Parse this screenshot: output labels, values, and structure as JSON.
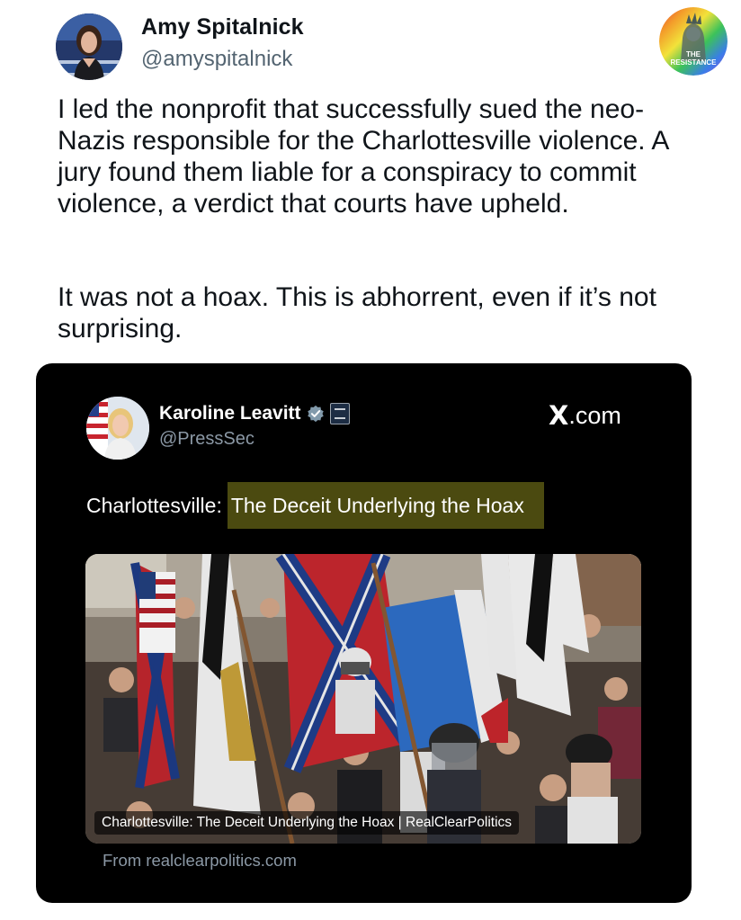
{
  "outer_tweet": {
    "author_name": "Amy Spitalnick",
    "author_handle": "@amyspitalnick",
    "avatar_icon": "profile-photo",
    "badge": {
      "icon": "statue-of-liberty-rainbow-badge",
      "label_line1": "THE",
      "label_line2": "RESISTANCE"
    },
    "paragraphs": [
      "I led the nonprofit that successfully sued the neo-Nazis responsible for the Charlottesville violence. A jury found them liable for a conspiracy to commit violence, a verdict that courts have upheld.",
      "It was not a hoax. This is abhorrent, even if it’s not surprising."
    ]
  },
  "quoted_tweet": {
    "author_name": "Karoline Leavitt",
    "author_handle": "@PressSec",
    "verified_icon": "verified-badge-icon",
    "affiliation_icon": "white-house-seal-icon",
    "source_site": ".com",
    "source_logo": "X",
    "text_prefix": "Charlottesville:",
    "text_highlight": "The Deceit Underlying the Hoax",
    "highlight_color": "#4b4a10",
    "link_card": {
      "caption": "Charlottesville: The Deceit Underlying the Hoax | RealClearPolitics",
      "source": "From realclearpolitics.com"
    }
  },
  "colors": {
    "background": "#ffffff",
    "card_background": "#000000",
    "primary_text": "#0f1419",
    "secondary_text": "#536471",
    "verified_blue": "#1d9bf0"
  }
}
